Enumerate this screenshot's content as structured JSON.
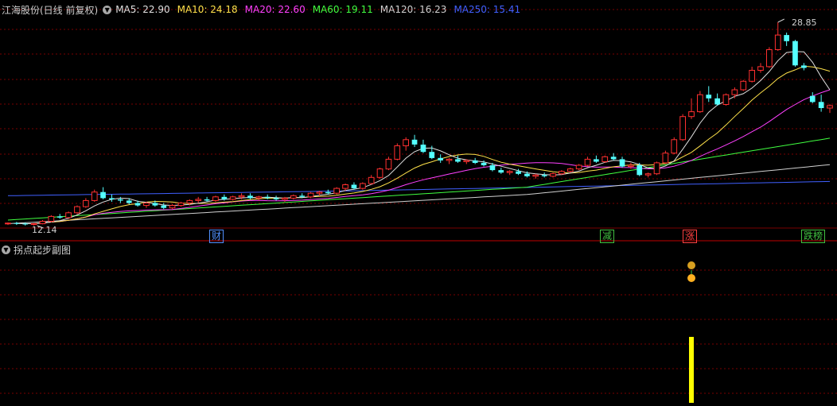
{
  "header": {
    "title": "江海股份(日线 前复权)",
    "ma": [
      {
        "label": "MA5: 22.90",
        "color": "#e0e0e0"
      },
      {
        "label": "MA10: 24.18",
        "color": "#ffe24a"
      },
      {
        "label": "MA20: 22.60",
        "color": "#ff40ff"
      },
      {
        "label": "MA60: 19.11",
        "color": "#40ff40"
      },
      {
        "label": "MA120: 16.23",
        "color": "#d0d0d0"
      },
      {
        "label": "MA250: 15.41",
        "color": "#4060ff"
      }
    ]
  },
  "price_high_label": "28.85",
  "price_low_label": "12.14",
  "event_tags": [
    {
      "text": "财",
      "color": "#5090ff"
    },
    {
      "text": "减",
      "color": "#40c040"
    },
    {
      "text": "涨",
      "color": "#ff4040"
    },
    {
      "text": "跌榜",
      "color": "#40c040"
    }
  ],
  "sub_chart": {
    "title": "拐点起步副图",
    "signal_color": "#ffff00",
    "signal_value": 1
  },
  "colors": {
    "up": "#ff3030",
    "down": "#54ffff",
    "grid": "#7a0000",
    "background": "#000000"
  },
  "chart_data": {
    "type": "candlestick",
    "price_range": [
      12.14,
      28.85
    ],
    "candles": [
      [
        12.3,
        12.4,
        12.2,
        12.35
      ],
      [
        12.35,
        12.45,
        12.2,
        12.3
      ],
      [
        12.3,
        12.4,
        12.15,
        12.25
      ],
      [
        12.25,
        12.35,
        12.14,
        12.3
      ],
      [
        12.3,
        12.6,
        12.25,
        12.5
      ],
      [
        12.5,
        13.0,
        12.4,
        12.9
      ],
      [
        12.9,
        13.1,
        12.7,
        12.8
      ],
      [
        12.8,
        13.3,
        12.75,
        13.2
      ],
      [
        13.2,
        13.8,
        13.1,
        13.7
      ],
      [
        13.7,
        14.4,
        13.6,
        14.2
      ],
      [
        14.2,
        15.1,
        14.1,
        14.9
      ],
      [
        14.9,
        15.3,
        14.3,
        14.4
      ],
      [
        14.4,
        14.7,
        14.1,
        14.3
      ],
      [
        14.3,
        14.5,
        14.0,
        14.2
      ],
      [
        14.2,
        14.4,
        13.9,
        14.0
      ],
      [
        14.0,
        14.2,
        13.7,
        13.8
      ],
      [
        13.8,
        14.1,
        13.6,
        14.0
      ],
      [
        14.0,
        14.2,
        13.7,
        13.8
      ],
      [
        13.8,
        14.0,
        13.5,
        13.6
      ],
      [
        13.6,
        13.9,
        13.5,
        13.8
      ],
      [
        13.8,
        14.1,
        13.7,
        14.0
      ],
      [
        14.0,
        14.3,
        13.8,
        14.2
      ],
      [
        14.2,
        14.5,
        14.0,
        14.3
      ],
      [
        14.3,
        14.5,
        14.1,
        14.2
      ],
      [
        14.2,
        14.6,
        14.1,
        14.5
      ],
      [
        14.5,
        14.7,
        14.2,
        14.3
      ],
      [
        14.3,
        14.6,
        14.2,
        14.5
      ],
      [
        14.5,
        14.8,
        14.3,
        14.6
      ],
      [
        14.6,
        14.8,
        14.3,
        14.4
      ],
      [
        14.4,
        14.6,
        14.2,
        14.5
      ],
      [
        14.5,
        14.7,
        14.3,
        14.4
      ],
      [
        14.4,
        14.6,
        14.2,
        14.3
      ],
      [
        14.3,
        14.5,
        14.1,
        14.4
      ],
      [
        14.4,
        14.7,
        14.3,
        14.6
      ],
      [
        14.6,
        14.8,
        14.4,
        14.5
      ],
      [
        14.5,
        14.9,
        14.4,
        14.8
      ],
      [
        14.8,
        15.0,
        14.6,
        14.9
      ],
      [
        14.9,
        15.1,
        14.7,
        14.8
      ],
      [
        14.8,
        15.3,
        14.7,
        15.2
      ],
      [
        15.2,
        15.6,
        15.0,
        15.5
      ],
      [
        15.5,
        15.7,
        15.1,
        15.2
      ],
      [
        15.2,
        15.7,
        15.1,
        15.6
      ],
      [
        15.6,
        16.3,
        15.5,
        16.1
      ],
      [
        16.1,
        16.9,
        16.0,
        16.8
      ],
      [
        16.8,
        17.8,
        16.7,
        17.6
      ],
      [
        17.6,
        18.9,
        17.5,
        18.7
      ],
      [
        18.7,
        19.4,
        18.3,
        19.2
      ],
      [
        19.2,
        19.6,
        18.6,
        18.8
      ],
      [
        18.8,
        19.2,
        18.1,
        18.2
      ],
      [
        18.2,
        18.7,
        17.6,
        17.7
      ],
      [
        17.7,
        18.0,
        17.3,
        17.5
      ],
      [
        17.5,
        17.7,
        17.2,
        17.6
      ],
      [
        17.6,
        17.9,
        17.3,
        17.4
      ],
      [
        17.4,
        17.6,
        17.2,
        17.5
      ],
      [
        17.5,
        17.7,
        17.2,
        17.3
      ],
      [
        17.3,
        17.5,
        17.0,
        17.1
      ],
      [
        17.1,
        17.3,
        16.6,
        16.7
      ],
      [
        16.7,
        16.9,
        16.4,
        16.5
      ],
      [
        16.5,
        16.7,
        16.3,
        16.6
      ],
      [
        16.6,
        16.8,
        16.3,
        16.4
      ],
      [
        16.4,
        16.6,
        16.1,
        16.2
      ],
      [
        16.2,
        16.4,
        16.0,
        16.3
      ],
      [
        16.3,
        16.5,
        16.1,
        16.2
      ],
      [
        16.2,
        16.5,
        16.1,
        16.4
      ],
      [
        16.4,
        16.7,
        16.3,
        16.6
      ],
      [
        16.6,
        16.9,
        16.5,
        16.8
      ],
      [
        16.8,
        17.2,
        16.7,
        17.1
      ],
      [
        17.1,
        17.8,
        17.0,
        17.6
      ],
      [
        17.6,
        17.9,
        17.3,
        17.4
      ],
      [
        17.4,
        17.9,
        17.3,
        17.8
      ],
      [
        17.8,
        18.1,
        17.5,
        17.6
      ],
      [
        17.6,
        17.8,
        16.9,
        17.0
      ],
      [
        17.0,
        17.3,
        16.8,
        17.1
      ],
      [
        17.1,
        17.3,
        16.2,
        16.3
      ],
      [
        16.3,
        16.5,
        16.1,
        16.4
      ],
      [
        16.4,
        17.4,
        16.3,
        17.3
      ],
      [
        17.3,
        18.3,
        17.2,
        18.1
      ],
      [
        18.1,
        19.4,
        18.0,
        19.2
      ],
      [
        19.2,
        21.3,
        19.1,
        21.1
      ],
      [
        21.1,
        22.6,
        20.9,
        21.5
      ],
      [
        21.5,
        23.2,
        21.4,
        22.9
      ],
      [
        22.9,
        23.6,
        22.3,
        22.6
      ],
      [
        22.6,
        23.0,
        22.0,
        22.1
      ],
      [
        22.1,
        23.0,
        22.0,
        22.9
      ],
      [
        22.9,
        23.5,
        22.6,
        23.3
      ],
      [
        23.3,
        24.1,
        23.2,
        24.0
      ],
      [
        24.0,
        25.2,
        23.9,
        24.9
      ],
      [
        24.9,
        25.5,
        24.7,
        25.2
      ],
      [
        25.2,
        26.8,
        25.1,
        26.6
      ],
      [
        26.6,
        28.85,
        26.5,
        27.8
      ],
      [
        27.8,
        28.0,
        26.9,
        27.3
      ],
      [
        27.3,
        27.4,
        25.2,
        25.3
      ],
      [
        25.3,
        25.5,
        24.9,
        25.1
      ],
      [
        22.8,
        23.1,
        22.2,
        22.3
      ],
      [
        22.3,
        22.9,
        21.5,
        21.8
      ],
      [
        21.8,
        22.1,
        21.4,
        22.0
      ]
    ]
  }
}
